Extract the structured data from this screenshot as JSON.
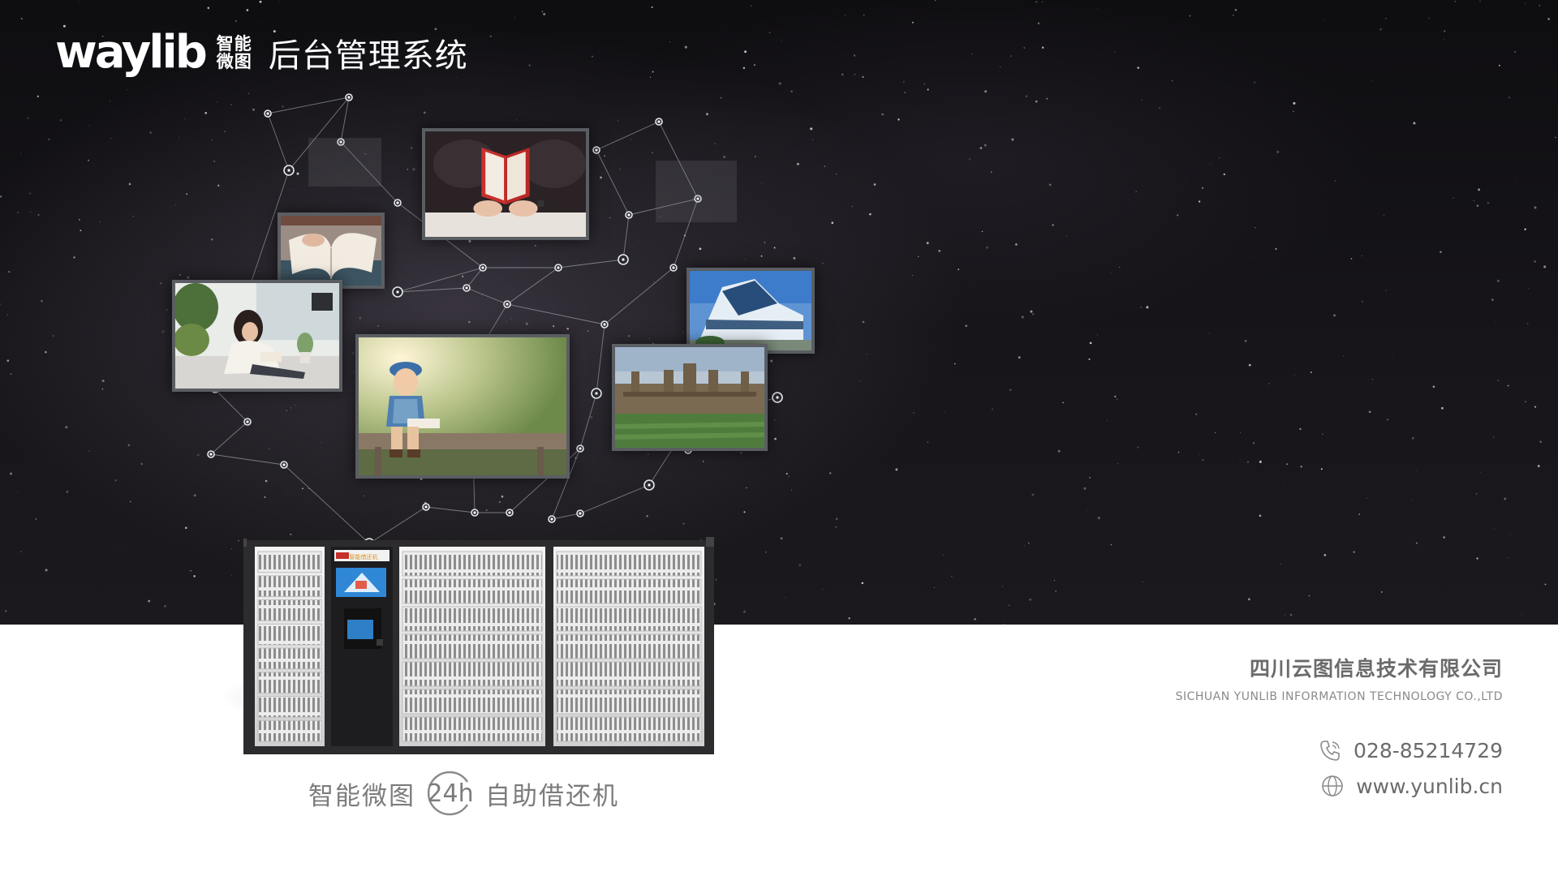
{
  "header": {
    "brand_wordmark": "waylib",
    "brand_cn_line1": "智能",
    "brand_cn_line2": "微图",
    "app_title": "后台管理系统"
  },
  "product": {
    "caption_before": "智能微图",
    "caption_badge": "24h",
    "caption_after": "自助借还机",
    "screen_label": "智能借还机"
  },
  "company": {
    "name_cn": "四川云图信息技术有限公司",
    "name_en": "SICHUAN YUNLIB  INFORMATION TECHNOLOGY CO.,LTD",
    "phone": "028-85214729",
    "website": "www.yunlib.cn"
  },
  "icons": {
    "phone": "phone-icon",
    "website": "globe-icon"
  },
  "colors": {
    "sky": "#141216",
    "text_gray": "#6b6b6b",
    "frame": "#5a5e63"
  }
}
